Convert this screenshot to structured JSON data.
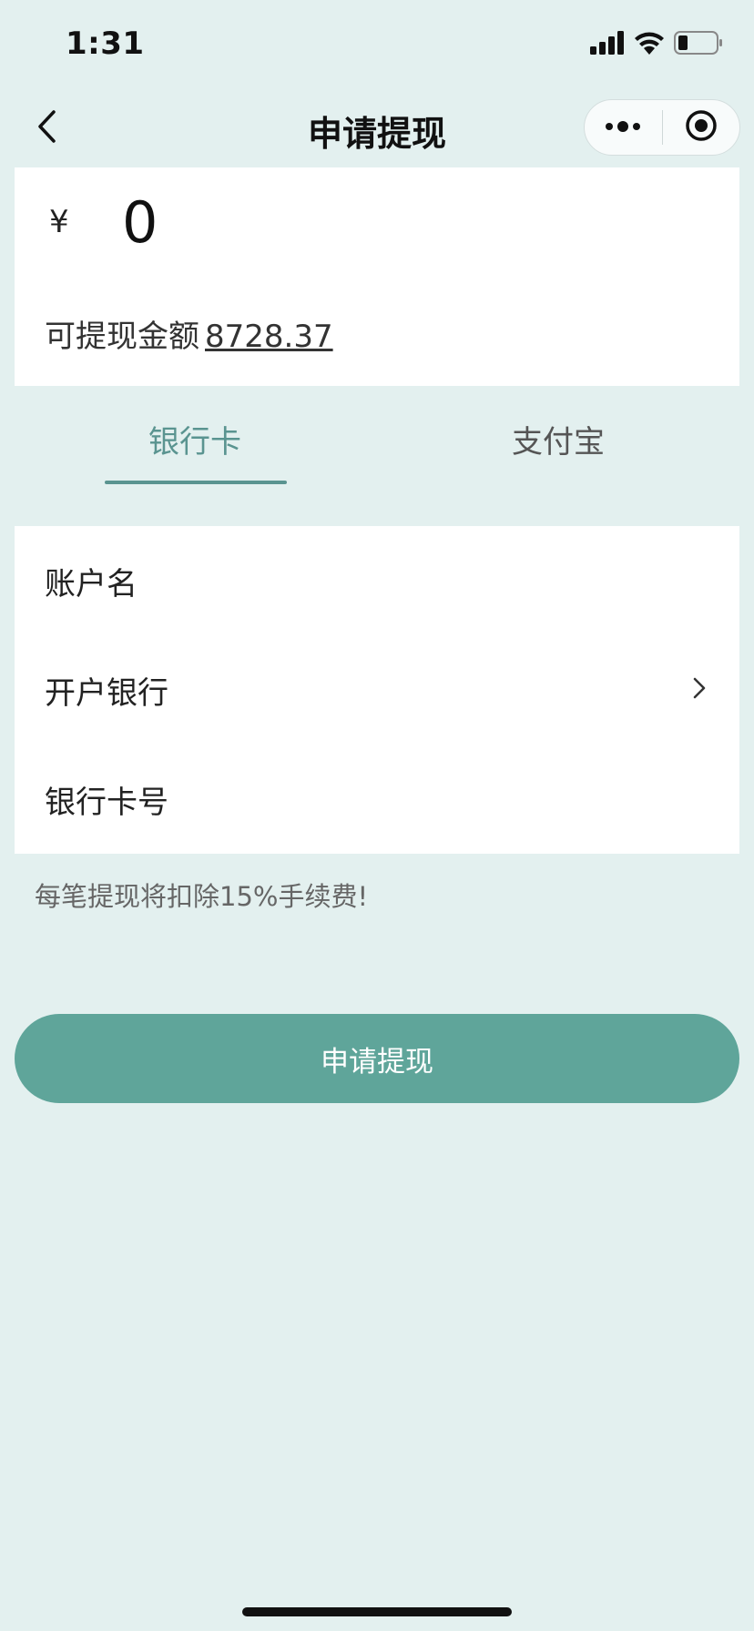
{
  "status_bar": {
    "time": "1:31",
    "icons": [
      "signal-icon",
      "wifi-icon",
      "battery-icon"
    ]
  },
  "nav": {
    "title": "申请提现",
    "icons": [
      "back-icon",
      "more-icon",
      "target-icon"
    ]
  },
  "amount": {
    "currency_symbol": "¥",
    "value": "0",
    "balance_label": "可提现金额",
    "balance_value": "8728.37"
  },
  "tabs": [
    {
      "label": "银行卡",
      "active": true
    },
    {
      "label": "支付宝",
      "active": false
    }
  ],
  "form": {
    "account_name_label": "账户名",
    "bank_label": "开户银行",
    "card_number_label": "银行卡号"
  },
  "notice": "每笔提现将扣除15%手续费!",
  "submit_label": "申请提现",
  "colors": {
    "background": "#e3f0ef",
    "accent": "#5a9490",
    "button": "#5fa59a"
  }
}
